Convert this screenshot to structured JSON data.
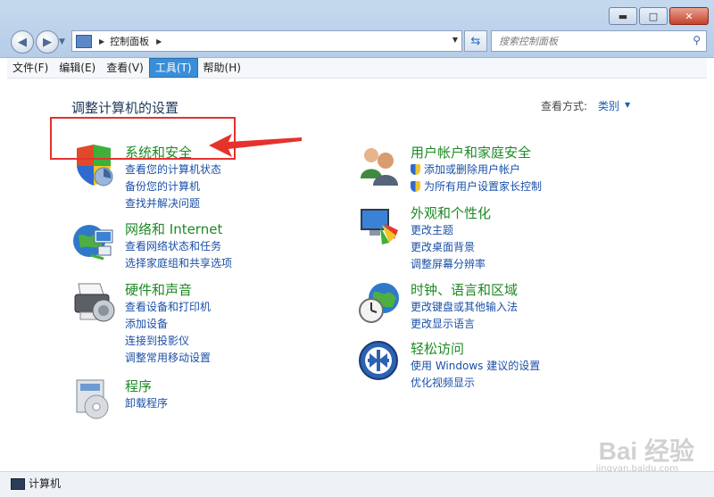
{
  "window": {
    "minimize": "▬",
    "maximize": "□",
    "close": "✕"
  },
  "address": {
    "path": "控制面板",
    "search_placeholder": "搜索控制面板"
  },
  "menubar": [
    {
      "label": "文件(F)"
    },
    {
      "label": "编辑(E)"
    },
    {
      "label": "查看(V)"
    },
    {
      "label": "工具(T)",
      "active": true
    },
    {
      "label": "帮助(H)"
    }
  ],
  "main": {
    "heading": "调整计算机的设置",
    "view_by_label": "查看方式:",
    "view_by_value": "类别"
  },
  "categories": {
    "system_security": {
      "title": "系统和安全",
      "links": [
        "查看您的计算机状态",
        "备份您的计算机",
        "查找并解决问题"
      ]
    },
    "network": {
      "title": "网络和 Internet",
      "links": [
        "查看网络状态和任务",
        "选择家庭组和共享选项"
      ]
    },
    "hardware": {
      "title": "硬件和声音",
      "links": [
        "查看设备和打印机",
        "添加设备",
        "连接到投影仪",
        "调整常用移动设置"
      ]
    },
    "programs": {
      "title": "程序",
      "links": [
        "卸载程序"
      ]
    },
    "user_accounts": {
      "title": "用户帐户和家庭安全",
      "links": [
        "添加或删除用户帐户",
        "为所有用户设置家长控制"
      ]
    },
    "appearance": {
      "title": "外观和个性化",
      "links": [
        "更改主题",
        "更改桌面背景",
        "调整屏幕分辨率"
      ]
    },
    "clock": {
      "title": "时钟、语言和区域",
      "links": [
        "更改键盘或其他输入法",
        "更改显示语言"
      ]
    },
    "ease": {
      "title": "轻松访问",
      "links": [
        "使用 Windows 建议的设置",
        "优化视频显示"
      ]
    }
  },
  "status": {
    "text": "计算机"
  },
  "watermark": {
    "text": "Bai 经验",
    "sub": "jingyan.baidu.com"
  }
}
